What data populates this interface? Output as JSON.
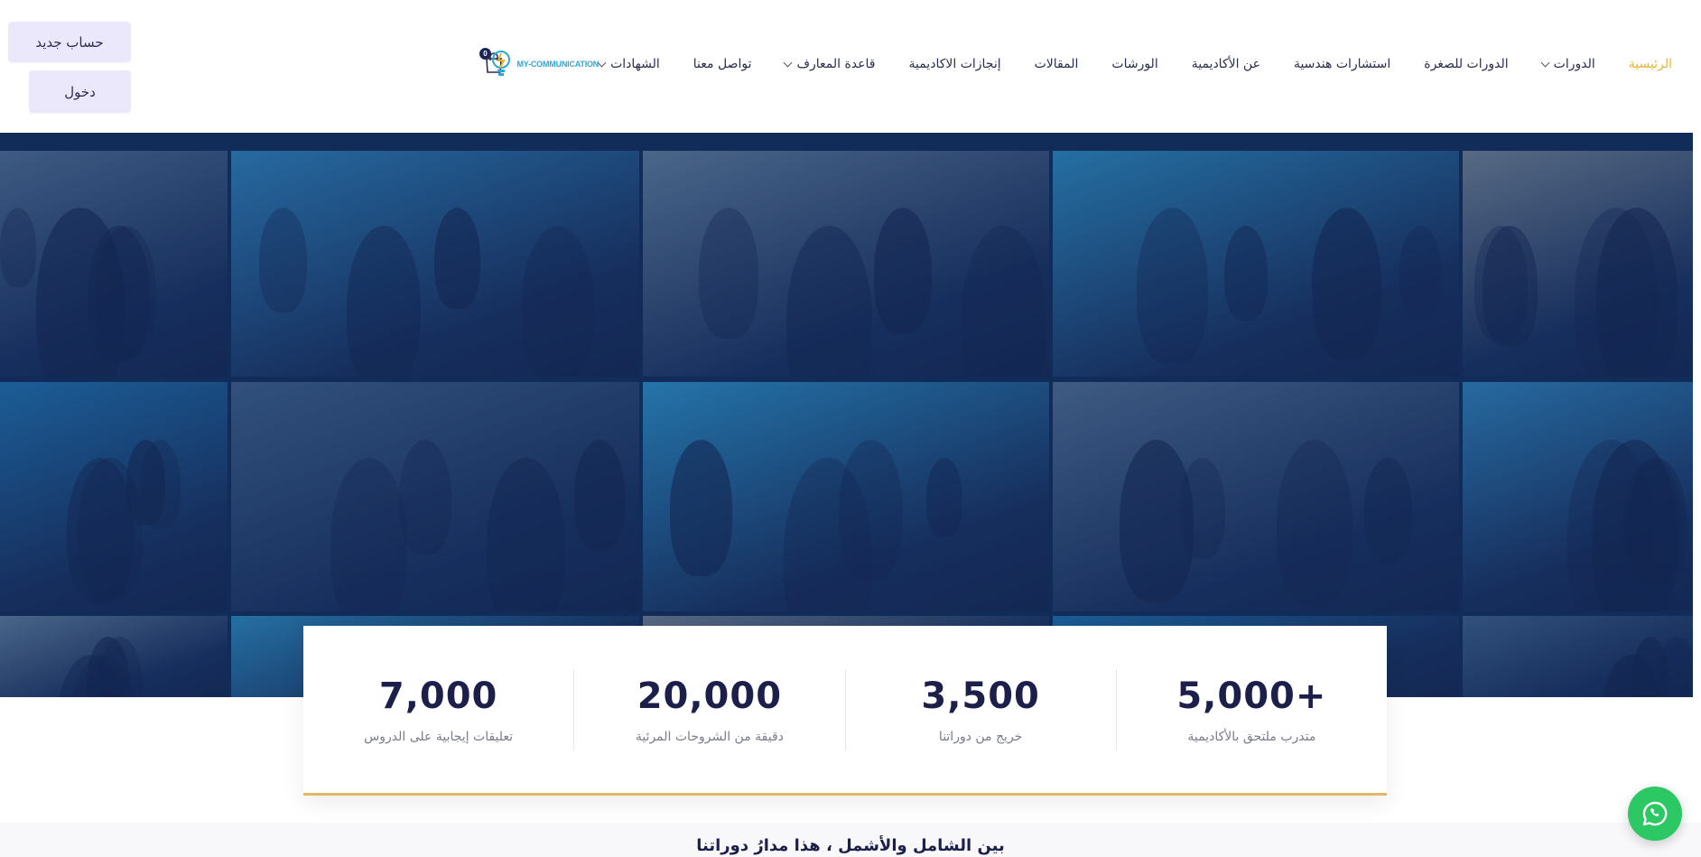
{
  "header": {
    "logo_text": "MY-COMMUNICATION",
    "nav": [
      {
        "label": "الرئيسية",
        "active": true,
        "dropdown": false
      },
      {
        "label": "الدورات",
        "active": false,
        "dropdown": true
      },
      {
        "label": "الدورات للصغرة",
        "active": false,
        "dropdown": false
      },
      {
        "label": "استشارات هندسية",
        "active": false,
        "dropdown": false
      },
      {
        "label": "عن الأكاديمية",
        "active": false,
        "dropdown": false
      },
      {
        "label": "الورشات",
        "active": false,
        "dropdown": false
      },
      {
        "label": "المقالات",
        "active": false,
        "dropdown": false
      },
      {
        "label": "إنجازات الاكاديمية",
        "active": false,
        "dropdown": false
      },
      {
        "label": "قاعدة المعارف",
        "active": false,
        "dropdown": true
      },
      {
        "label": "تواصل معنا",
        "active": false,
        "dropdown": false
      },
      {
        "label": "الشهادات",
        "active": false,
        "dropdown": true
      }
    ],
    "cart_count": "0",
    "register_label": "حساب جديد",
    "login_label": "دخول"
  },
  "stats": [
    {
      "value": "5,000+",
      "label": "متدرب ملتحق بالأكاديمية"
    },
    {
      "value": "3,500",
      "label": "خريج من دوراتنا"
    },
    {
      "value": "20,000",
      "label": "دقيقة من الشروحات المرئية"
    },
    {
      "value": "7,000",
      "label": "تعليقات إيجابية على الدروس"
    }
  ],
  "tagline": "بين الشامل والأشمل ، هذا مدارُ دوراتنا",
  "colors": {
    "accent": "#e7b534",
    "navy": "#1b1f4a",
    "whatsapp": "#2bc864",
    "auth_button_bg": "#ebe8fb"
  },
  "icons": {
    "cart": "shopping-bag-icon",
    "whatsapp": "whatsapp-icon",
    "logo": "lightbulb-logo-icon"
  }
}
